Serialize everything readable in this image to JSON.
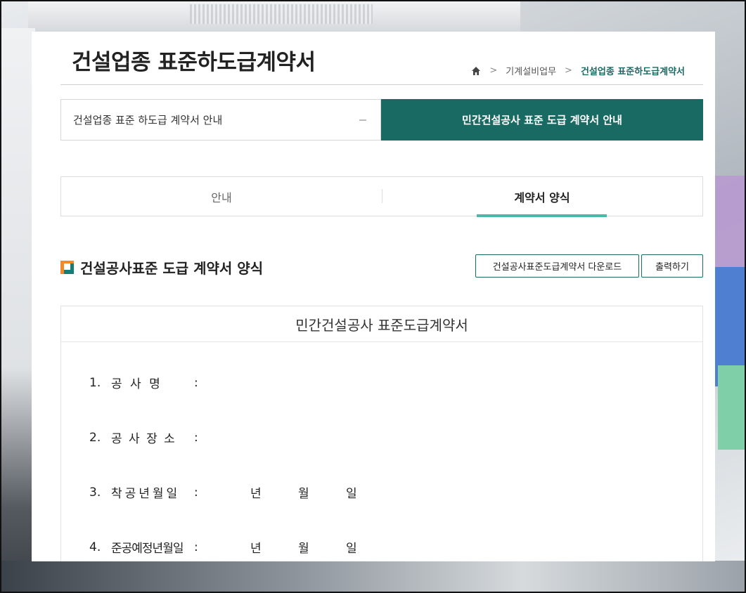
{
  "page": {
    "title": "건설업종 표준하도급계약서",
    "breadcrumb": [
      "기계설비업무",
      "건설업종 표준하도급계약서"
    ]
  },
  "sub_tabs": [
    {
      "label": "건설업종 표준 하도급 계약서 안내",
      "active": false
    },
    {
      "label": "민간건설공사 표준 도급 계약서 안내",
      "active": true
    }
  ],
  "tabs": [
    {
      "label": "안내",
      "active": false
    },
    {
      "label": "계약서 양식",
      "active": true
    }
  ],
  "section": {
    "title": "건설공사표준 도급 계약서 양식",
    "download_label": "건설공사표준도급계약서 다운로드",
    "print_label": "출력하기"
  },
  "document": {
    "title": "민간건설공사 표준도급계약서",
    "fields": [
      {
        "num": "1.",
        "label": "공  사  명",
        "colon": ":",
        "date": null
      },
      {
        "num": "2.",
        "label": "공 사 장 소",
        "colon": ":",
        "date": null
      },
      {
        "num": "3.",
        "label": "착공년월일",
        "colon": ":",
        "date": [
          "년",
          "월",
          "일"
        ]
      },
      {
        "num": "4.",
        "label": "준공예정년월일",
        "colon": ":",
        "date": [
          "년",
          "월",
          "일"
        ]
      }
    ]
  },
  "colors": {
    "accent": "#196a63",
    "tab_underline": "#4db8a8",
    "icon_orange": "#f08a2a"
  }
}
